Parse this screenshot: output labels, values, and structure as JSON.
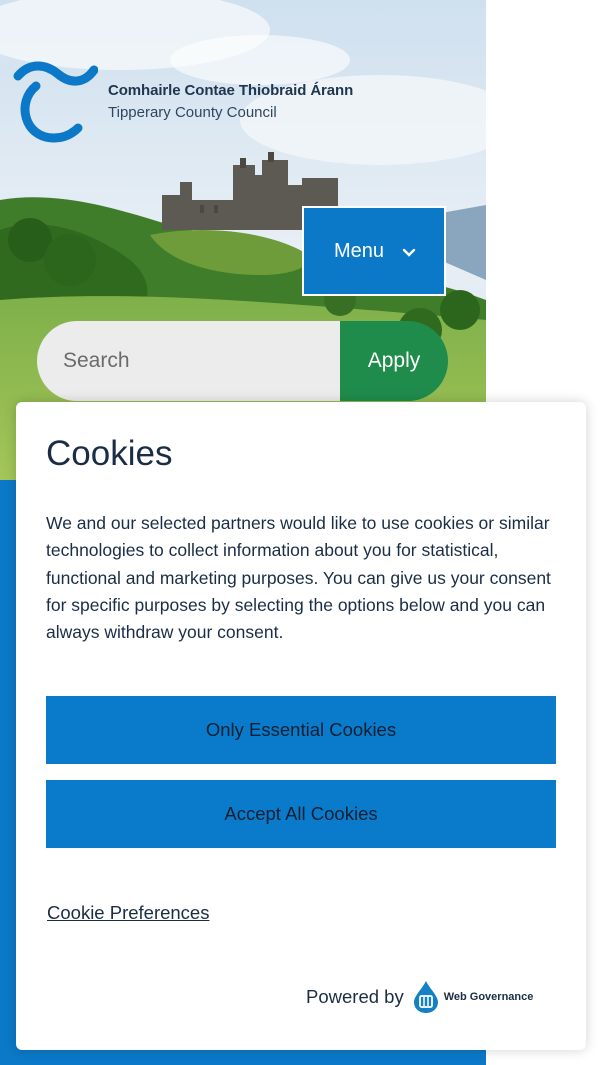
{
  "header": {
    "org_name_irish": "Comhairle Contae Thiobraid Árann",
    "org_name_english": "Tipperary County Council",
    "logo_icon": "tipperary-tilde-logo",
    "menu_label": "Menu",
    "menu_icon": "chevron-down-icon"
  },
  "search": {
    "placeholder": "Search",
    "submit_label": "Apply"
  },
  "cookie_dialog": {
    "title": "Cookies",
    "body": "We and our selected partners would like to use cookies or similar technologies to collect information about you for statistical, functional and marketing purposes. You can give us your consent for specific purposes by selecting the options below and you can always withdraw your consent.",
    "essential_label": "Only Essential Cookies",
    "accept_label": "Accept All Cookies",
    "preferences_label": "Cookie Preferences",
    "powered_by_label": "Powered by",
    "vendor_name": "Web Governance"
  },
  "colors": {
    "brand_blue": "#0b79c7",
    "apply_green": "#1f8c4c",
    "text_dark": "#1b2d45"
  }
}
